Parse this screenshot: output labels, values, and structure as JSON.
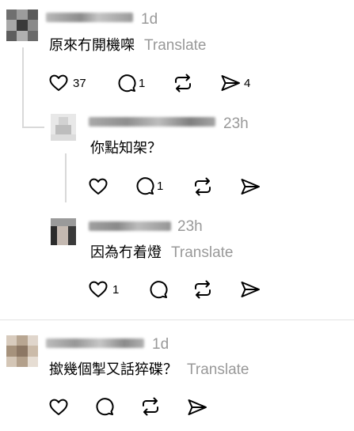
{
  "comments": [
    {
      "time": "1d",
      "text": "原來冇開機㗎",
      "translate_label": "Translate",
      "like_count": "37",
      "reply_count": "1",
      "share_count": "4"
    },
    {
      "time": "23h",
      "text": "你點知架？",
      "reply_count": "1"
    },
    {
      "time": "23h",
      "text": "因為冇着燈",
      "translate_label": "Translate",
      "like_count": "1"
    },
    {
      "time": "1d",
      "text": "撳幾個掣又話猝碟？",
      "translate_label": "Translate"
    }
  ],
  "icons": {
    "like": "heart-icon",
    "reply": "comment-icon",
    "repost": "repost-icon",
    "share": "send-icon"
  },
  "colors": {
    "secondary_text": "#999999",
    "divider": "#e3e3e3"
  }
}
